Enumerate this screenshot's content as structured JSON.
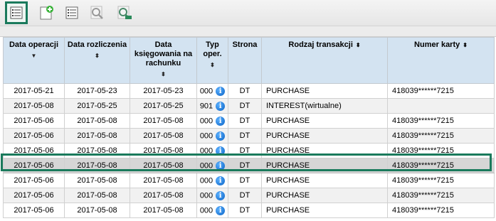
{
  "toolbar": {
    "buttons": [
      "list-view-icon",
      "add-document-icon",
      "details-icon",
      "search-icon",
      "advanced-search-icon"
    ]
  },
  "table": {
    "headers": {
      "data_operacji": "Data operacji",
      "data_rozliczenia": "Data rozliczenia",
      "data_ksiegowania": "Data księgowania na rachunku",
      "typ_oper": "Typ oper.",
      "strona": "Strona",
      "rodzaj_transakcji": "Rodzaj transakcji",
      "numer_karty": "Numer karty"
    },
    "rows": [
      {
        "op": "2017-05-21",
        "rozl": "2017-05-23",
        "ksieg": "2017-05-23",
        "typ": "000",
        "strona": "DT",
        "rodzaj": "PURCHASE",
        "karta": "418039******7215"
      },
      {
        "op": "2017-05-08",
        "rozl": "2017-05-25",
        "ksieg": "2017-05-25",
        "typ": "901",
        "strona": "DT",
        "rodzaj": "INTEREST(wirtualne)",
        "karta": ""
      },
      {
        "op": "2017-05-06",
        "rozl": "2017-05-08",
        "ksieg": "2017-05-08",
        "typ": "000",
        "strona": "DT",
        "rodzaj": "PURCHASE",
        "karta": "418039******7215"
      },
      {
        "op": "2017-05-06",
        "rozl": "2017-05-08",
        "ksieg": "2017-05-08",
        "typ": "000",
        "strona": "DT",
        "rodzaj": "PURCHASE",
        "karta": "418039******7215"
      },
      {
        "op": "2017-05-06",
        "rozl": "2017-05-08",
        "ksieg": "2017-05-08",
        "typ": "000",
        "strona": "DT",
        "rodzaj": "PURCHASE",
        "karta": "418039******7215"
      },
      {
        "op": "2017-05-06",
        "rozl": "2017-05-08",
        "ksieg": "2017-05-08",
        "typ": "000",
        "strona": "DT",
        "rodzaj": "PURCHASE",
        "karta": "418039******7215"
      },
      {
        "op": "2017-05-06",
        "rozl": "2017-05-08",
        "ksieg": "2017-05-08",
        "typ": "000",
        "strona": "DT",
        "rodzaj": "PURCHASE",
        "karta": "418039******7215"
      },
      {
        "op": "2017-05-06",
        "rozl": "2017-05-08",
        "ksieg": "2017-05-08",
        "typ": "000",
        "strona": "DT",
        "rodzaj": "PURCHASE",
        "karta": "418039******7215"
      },
      {
        "op": "2017-05-06",
        "rozl": "2017-05-08",
        "ksieg": "2017-05-08",
        "typ": "000",
        "strona": "DT",
        "rodzaj": "PURCHASE",
        "karta": "418039******7215"
      }
    ]
  },
  "info_glyph": "i",
  "sort_glyph": "⬍",
  "sort_active_glyph": "▼",
  "selected_row_index": 5,
  "colors": {
    "highlight": "#1a7a5c",
    "header_bg": "#d3e3f1",
    "info_blue": "#0b63c5"
  }
}
